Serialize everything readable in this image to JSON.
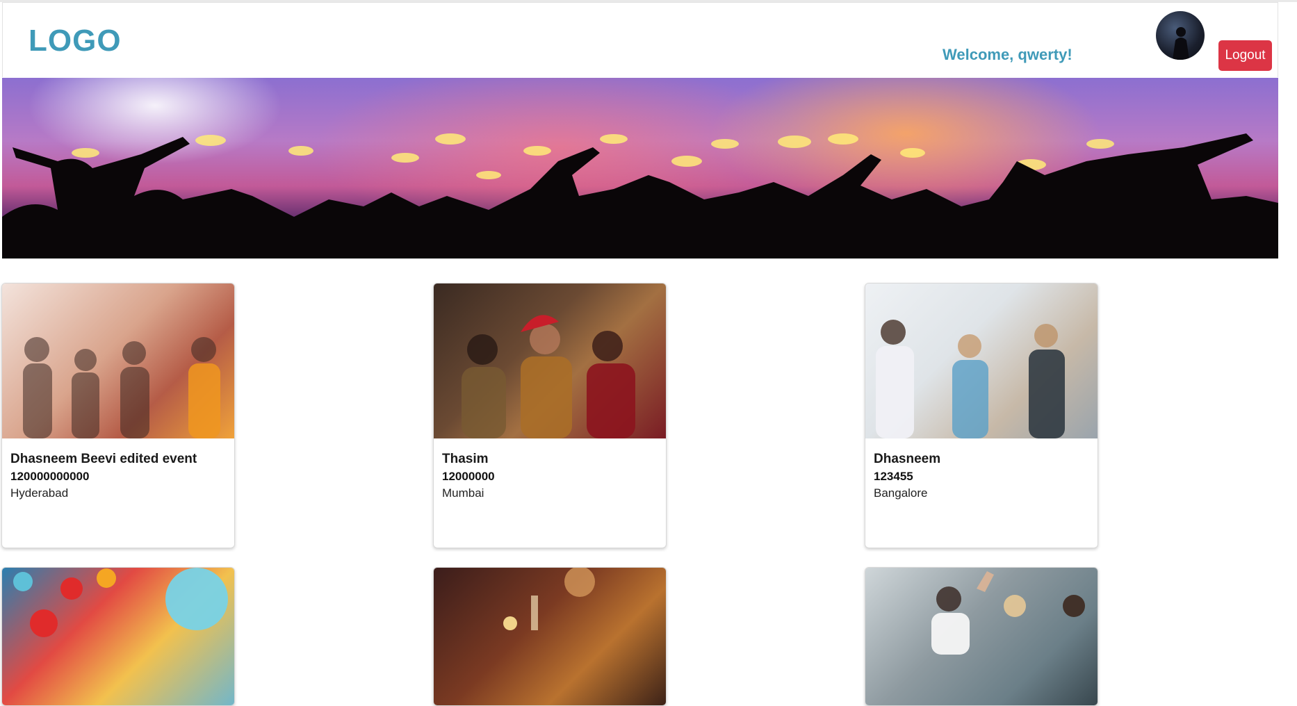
{
  "header": {
    "logo_text": "LOGO",
    "welcome_text": "Welcome, qwerty!",
    "logout_label": "Logout"
  },
  "colors": {
    "brand": "#3f9ab8",
    "logout_button": "#dc3545"
  },
  "banner": {
    "icon": "party-crowd-banner"
  },
  "events": [
    {
      "title": "Dhasneem Beevi edited event",
      "price": "120000000000",
      "location": "Hyderabad",
      "image": "office-party-confetti-photo"
    },
    {
      "title": "Thasim",
      "price": "12000000",
      "location": "Mumbai",
      "image": "christmas-sparklers-photo"
    },
    {
      "title": "Dhasneem",
      "price": "123455",
      "location": "Bangalore",
      "image": "office-celebration-photo"
    },
    {
      "title": "",
      "price": "",
      "location": "",
      "image": "balloons-crowd-photo"
    },
    {
      "title": "",
      "price": "",
      "location": "",
      "image": "champagne-toast-photo"
    },
    {
      "title": "",
      "price": "",
      "location": "",
      "image": "high-five-office-photo"
    }
  ]
}
